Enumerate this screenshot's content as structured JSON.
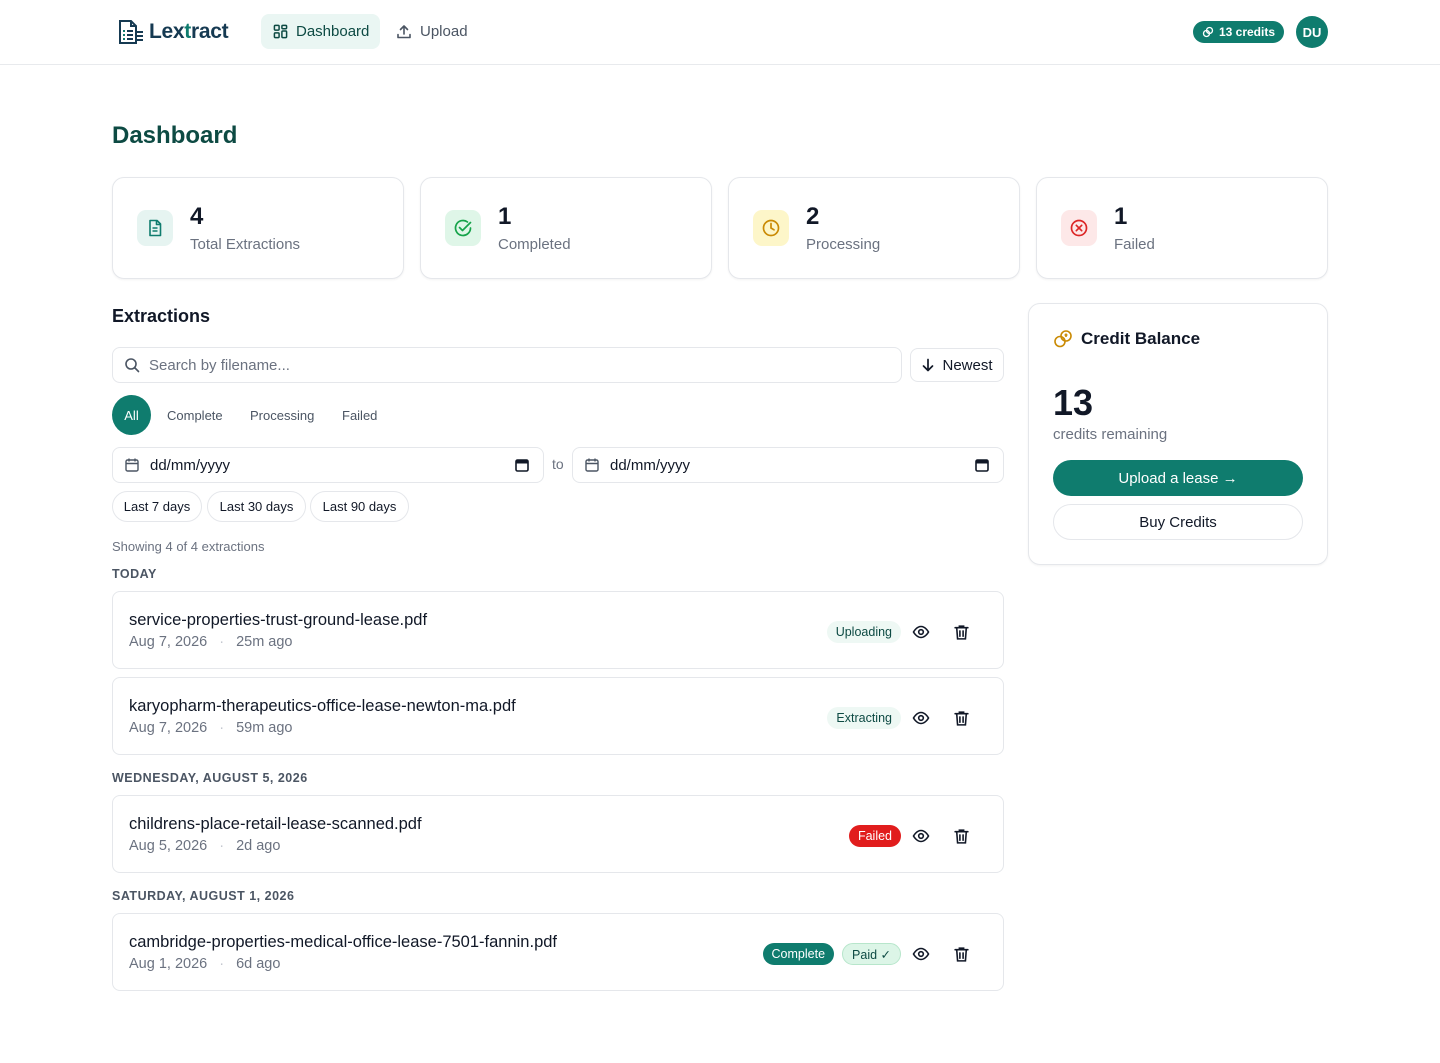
{
  "brand": {
    "logo_text_a": "Lex",
    "logo_text_b": "t",
    "logo_text_c": "ract"
  },
  "nav": {
    "dashboard": "Dashboard",
    "upload": "Upload"
  },
  "header": {
    "credits": "13 credits",
    "avatar": "DU"
  },
  "page_title": "Dashboard",
  "stats": [
    {
      "value": "4",
      "label": "Total Extractions",
      "icon": "document-icon",
      "color": "#0f7c6e"
    },
    {
      "value": "1",
      "label": "Completed",
      "icon": "check-circle-icon",
      "color": "#16a34a"
    },
    {
      "value": "2",
      "label": "Processing",
      "icon": "clock-icon",
      "color": "#ca8a04"
    },
    {
      "value": "1",
      "label": "Failed",
      "icon": "x-circle-icon",
      "color": "#dc2626"
    }
  ],
  "extractions": {
    "title": "Extractions",
    "search_placeholder": "Search by filename...",
    "sort_label": "Newest",
    "filters": [
      "All",
      "Complete",
      "Processing",
      "Failed"
    ],
    "date_from_placeholder": "dd/mm/yyyy",
    "date_to_placeholder": "dd/mm/yyyy",
    "to_label": "to",
    "quick_ranges": [
      "Last 7 days",
      "Last 30 days",
      "Last 90 days"
    ],
    "showing": "Showing 4 of 4 extractions",
    "groups": [
      "TODAY",
      "WEDNESDAY, AUGUST 5, 2026",
      "SATURDAY, AUGUST 1, 2026"
    ],
    "rows": [
      {
        "filename": "service-properties-trust-ground-lease.pdf",
        "date": "Aug 7, 2026",
        "ago": "25m ago",
        "status": "Uploading"
      },
      {
        "filename": "karyopharm-therapeutics-office-lease-newton-ma.pdf",
        "date": "Aug 7, 2026",
        "ago": "59m ago",
        "status": "Extracting"
      },
      {
        "filename": "childrens-place-retail-lease-scanned.pdf",
        "date": "Aug 5, 2026",
        "ago": "2d ago",
        "status": "Failed"
      },
      {
        "filename": "cambridge-properties-medical-office-lease-7501-fannin.pdf",
        "date": "Aug 1, 2026",
        "ago": "6d ago",
        "status": "Complete",
        "paid": "Paid ✓"
      }
    ]
  },
  "credit_balance": {
    "title": "Credit Balance",
    "value": "13",
    "sub": "credits remaining",
    "upload_button": "Upload a lease →",
    "buy_button": "Buy Credits"
  },
  "colors": {
    "accent": "#0f7c6e",
    "title": "#0d4a43",
    "danger": "#e11d1d"
  }
}
